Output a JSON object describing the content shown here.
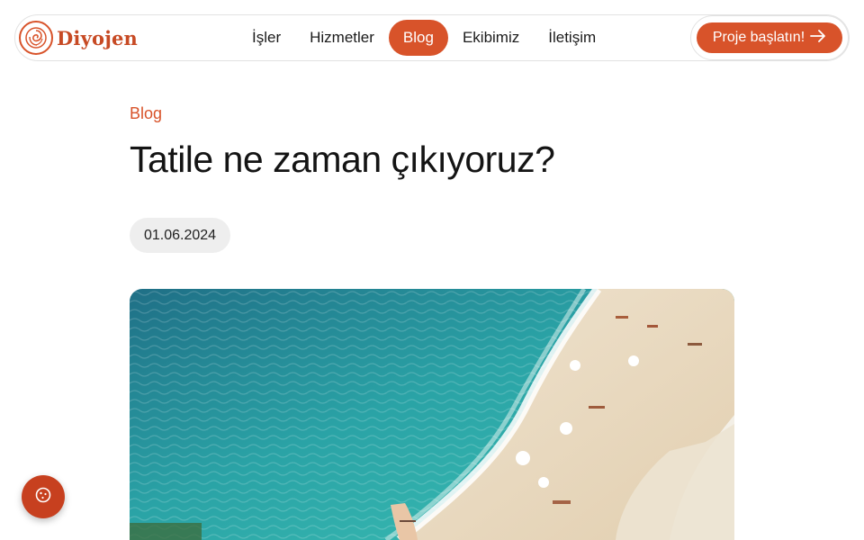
{
  "brand": {
    "name": "Diyojen",
    "logo_icon": "swirl-logo-icon"
  },
  "nav": {
    "items": [
      {
        "label": "İşler",
        "active": false
      },
      {
        "label": "Hizmetler",
        "active": false
      },
      {
        "label": "Blog",
        "active": true
      },
      {
        "label": "Ekibimiz",
        "active": false
      },
      {
        "label": "İletişim",
        "active": false
      }
    ],
    "cta_label": "Proje başlatın!",
    "cta_icon": "arrow-right-icon"
  },
  "post": {
    "category": "Blog",
    "title": "Tatile ne zaman çıkıyoruz?",
    "date": "01.06.2024",
    "hero_image": "beach-aerial-photo"
  },
  "floating_button": {
    "icon": "cookie-icon"
  },
  "colors": {
    "accent": "#d8532a",
    "accent_dark": "#c7401f",
    "pill_bg": "#eeeeee",
    "text": "#141414"
  }
}
